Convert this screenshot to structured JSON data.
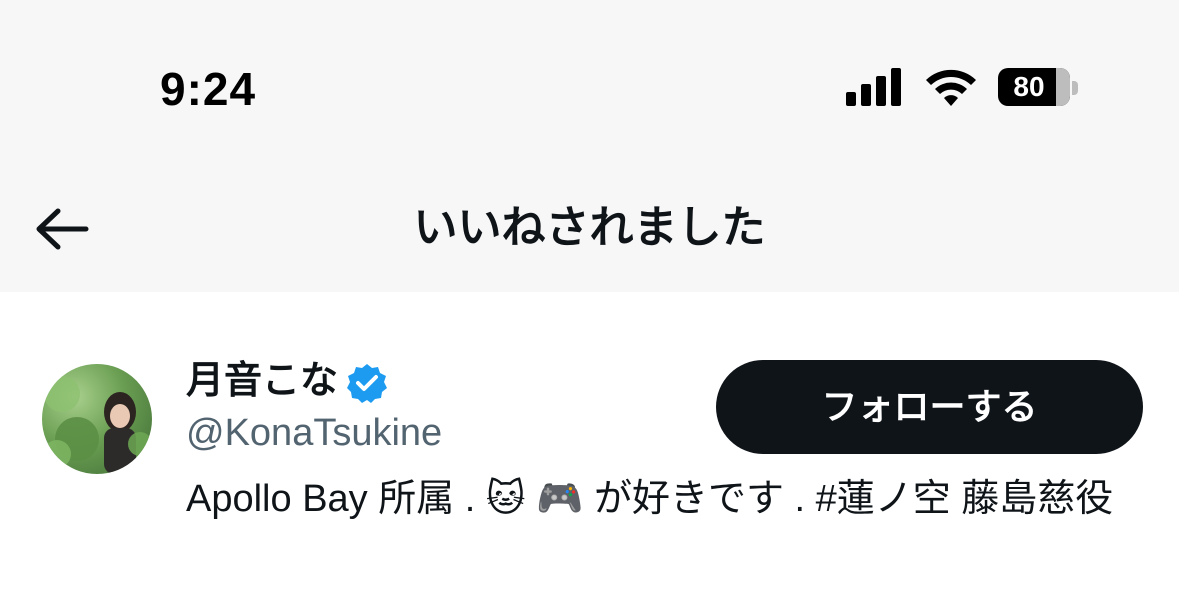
{
  "status_bar": {
    "time": "9:24",
    "battery_percent": "80",
    "battery_level": 0.8,
    "signal_bars": 4,
    "icons": [
      "signal-icon",
      "wifi-icon",
      "battery-icon"
    ]
  },
  "nav": {
    "title": "いいねされました",
    "back_icon": "arrow-left-icon"
  },
  "user": {
    "display_name": "月音こな",
    "verified": true,
    "handle": "@KonaTsukine",
    "follow_label": "フォローする",
    "bio": "Apollo Bay 所属 . 🐱 🎮 が好きです . #蓮ノ空 藤島慈役"
  },
  "colors": {
    "header_bg": "#f7f7f7",
    "text": "#0f1419",
    "secondary_text": "#536471",
    "button_bg": "#0f1419",
    "verified_badge": "#1d9bf0"
  }
}
